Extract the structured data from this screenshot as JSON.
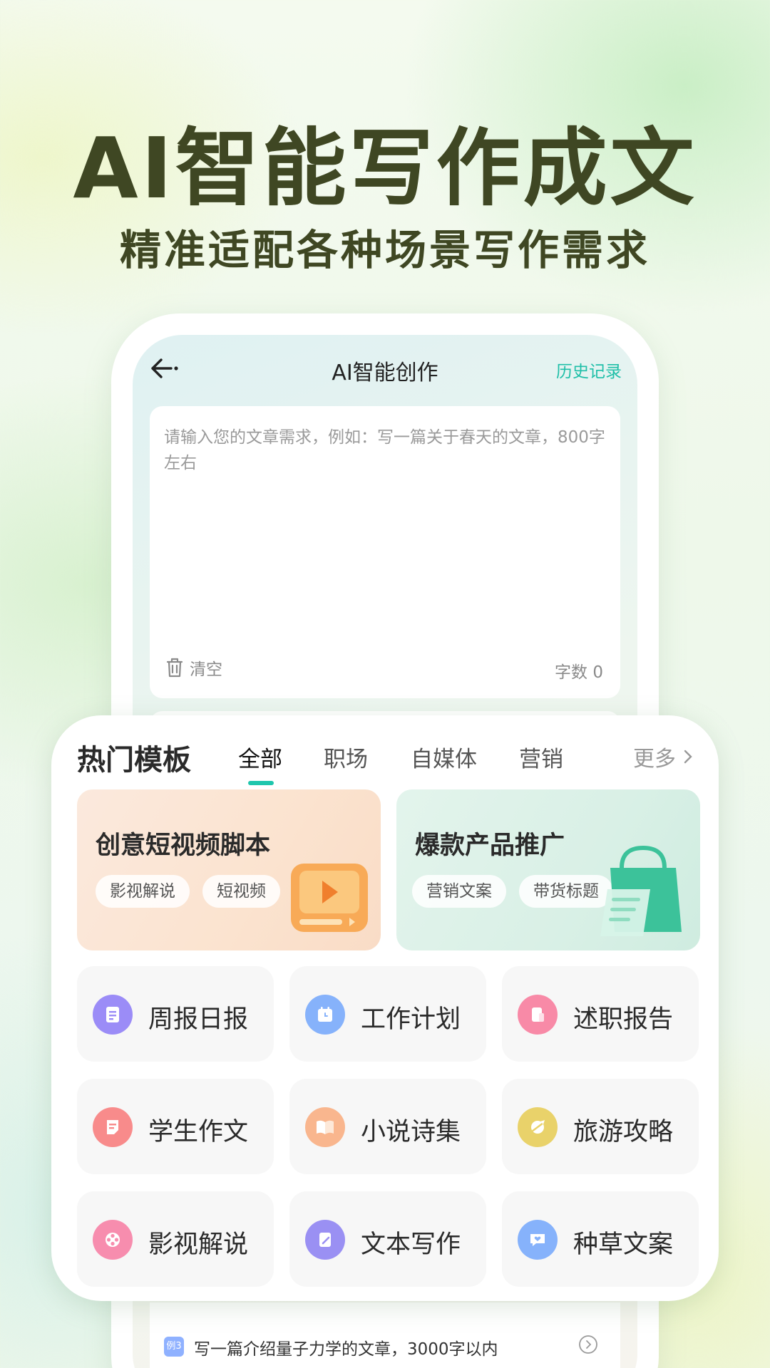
{
  "hero": {
    "title": "AI智能写作成文",
    "subtitle": "精准适配各种场景写作需求"
  },
  "app": {
    "title": "AI智能创作",
    "history": "历史记录",
    "editor": {
      "placeholder": "请输入您的文章需求，例如：写一篇关于春天的文章，800字左右",
      "clear_label": "清空",
      "word_count": "字数 0"
    },
    "example": {
      "tag": "例3",
      "text": "写一篇介绍量子力学的文章，3000字以内"
    }
  },
  "templates": {
    "heading": "热门模板",
    "tabs": [
      {
        "label": "全部",
        "active": true
      },
      {
        "label": "职场",
        "active": false
      },
      {
        "label": "自媒体",
        "active": false
      },
      {
        "label": "营销",
        "active": false
      }
    ],
    "more": "更多",
    "features": [
      {
        "title": "创意短视频脚本",
        "chips": [
          "影视解说",
          "短视频"
        ],
        "icon": "video-play-icon",
        "color": "#f7a44a"
      },
      {
        "title": "爆款产品推广",
        "chips": [
          "营销文案",
          "带货标题"
        ],
        "icon": "shopping-bag-icon",
        "color": "#3cc29a"
      }
    ],
    "tiles": [
      {
        "label": "周报日报",
        "icon": "notepad-icon",
        "color": "#9b8cf7"
      },
      {
        "label": "工作计划",
        "icon": "calendar-clock-icon",
        "color": "#86b2fb"
      },
      {
        "label": "述职报告",
        "icon": "report-icon",
        "color": "#f88aa7"
      },
      {
        "label": "学生作文",
        "icon": "essay-icon",
        "color": "#f88b8b"
      },
      {
        "label": "小说诗集",
        "icon": "book-icon",
        "color": "#f9b68e"
      },
      {
        "label": "旅游攻略",
        "icon": "travel-icon",
        "color": "#e9d26a"
      },
      {
        "label": "影视解说",
        "icon": "film-reel-icon",
        "color": "#f78dae"
      },
      {
        "label": "文本写作",
        "icon": "pen-doc-icon",
        "color": "#9a90f3"
      },
      {
        "label": "种草文案",
        "icon": "heart-chat-icon",
        "color": "#86b2fb"
      }
    ]
  }
}
